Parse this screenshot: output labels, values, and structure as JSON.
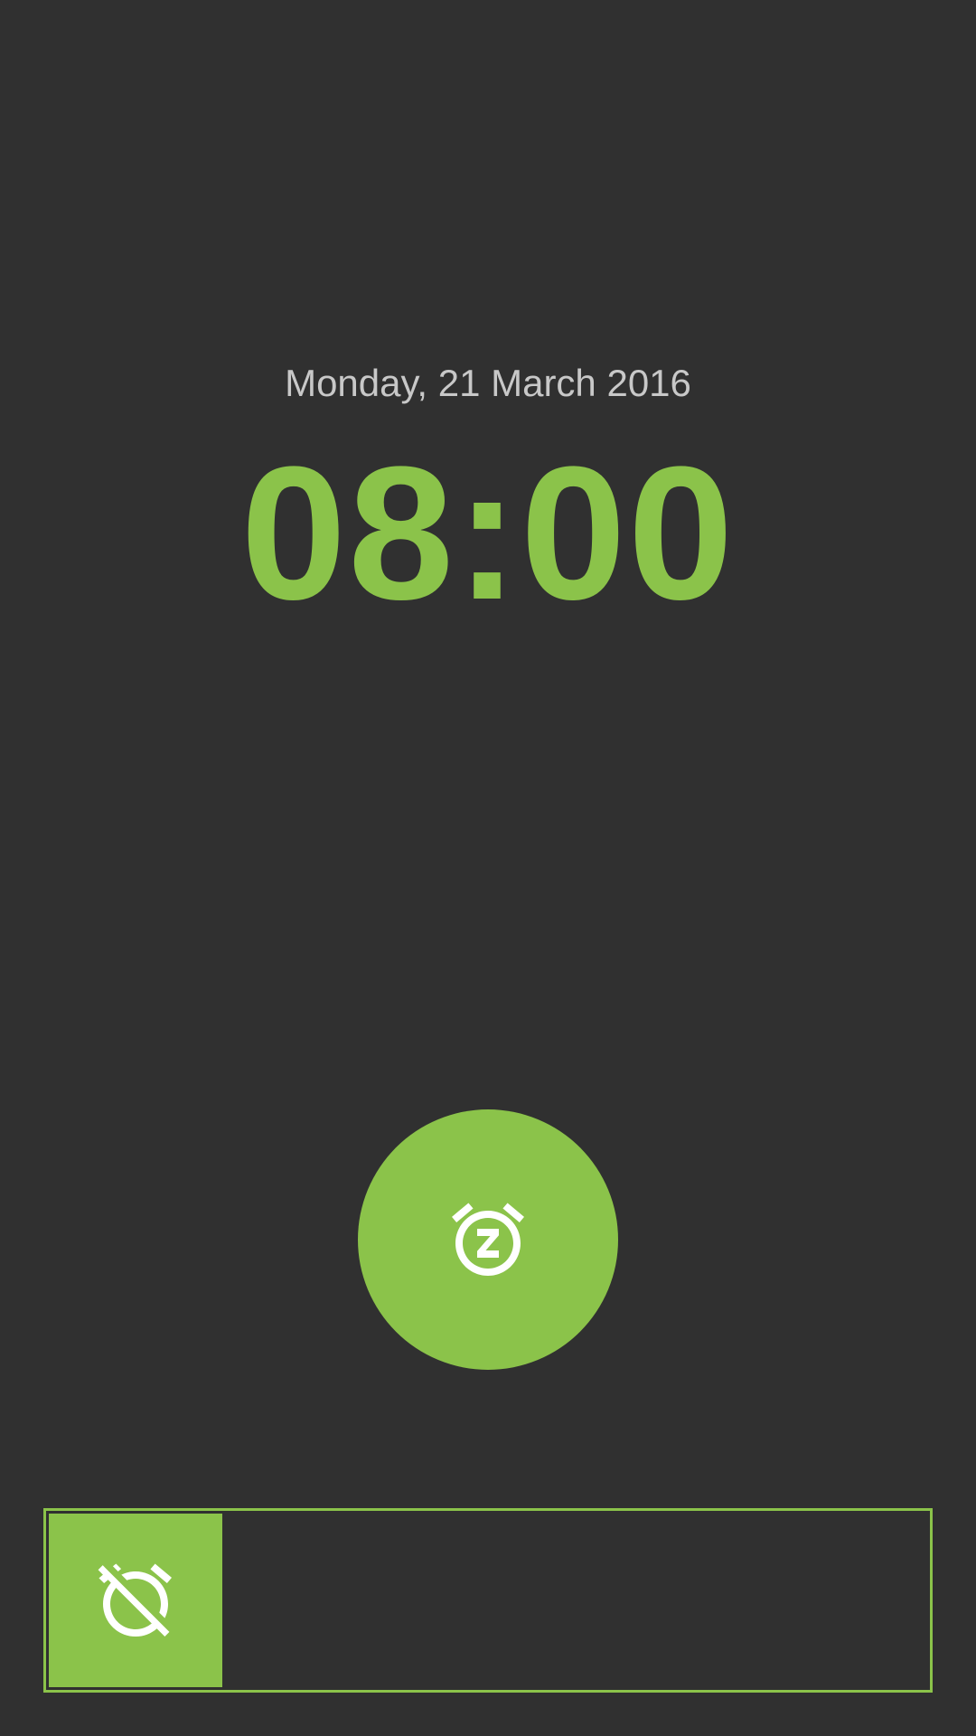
{
  "alarm": {
    "date": "Monday, 21 March 2016",
    "time": "08:00"
  },
  "actions": {
    "snooze_icon": "snooze-alarm-icon",
    "dismiss_icon": "alarm-off-icon"
  },
  "colors": {
    "background": "#303030",
    "accent": "#8bc34a",
    "date_text": "#c8c8c8",
    "icon": "#ffffff"
  }
}
